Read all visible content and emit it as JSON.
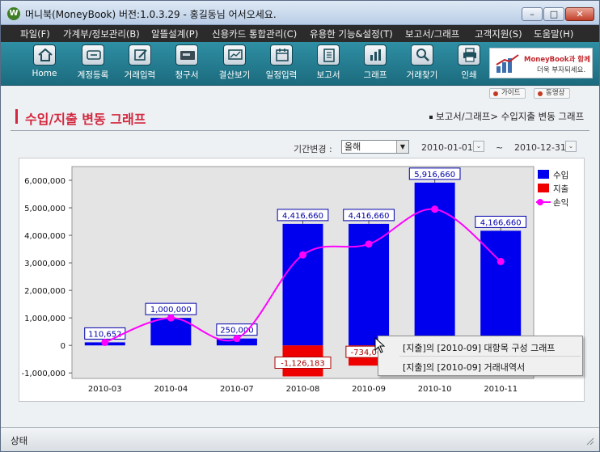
{
  "window": {
    "title": "머니북(MoneyBook) 버전:1.0.3.29 - 홍길동님 어서오세요.",
    "app_icon_letter": "W"
  },
  "menu": [
    "파일(F)",
    "가계부/정보관리(B)",
    "알뜰설계(P)",
    "신용카드 통합관리(C)",
    "유용한 기능&설정(T)",
    "보고서/그래프",
    "고객지원(S)",
    "도움말(H)"
  ],
  "toolbar": {
    "buttons": [
      {
        "label": "Home",
        "icon": "home-icon"
      },
      {
        "label": "계정등록",
        "icon": "account-register-icon"
      },
      {
        "label": "거래입력",
        "icon": "transaction-entry-icon"
      },
      {
        "label": "청구서",
        "icon": "bill-card-icon"
      },
      {
        "label": "결산보기",
        "icon": "settlement-monitor-icon"
      },
      {
        "label": "일정입력",
        "icon": "schedule-calendar-icon"
      },
      {
        "label": "보고서",
        "icon": "report-icon"
      },
      {
        "label": "그래프",
        "icon": "bar-graph-icon"
      },
      {
        "label": "거래찾기",
        "icon": "magnifier-icon"
      },
      {
        "label": "인쇄",
        "icon": "printer-icon"
      }
    ],
    "ad_line1": "MoneyBook과 함께",
    "ad_line2": "더욱 부자되세요."
  },
  "sub_buttons": {
    "guide": "가이드",
    "video": "동영상"
  },
  "page": {
    "title": "수입/지출 변동 그래프",
    "breadcrumb": "보고서/그래프> 수입지출 변동 그래프"
  },
  "filter": {
    "period_label": "기간변경 :",
    "period_value": "올해",
    "start_date": "2010-01-01",
    "end_date": "2010-12-31",
    "tilde": "~"
  },
  "chart_data": {
    "type": "bar",
    "categories": [
      "2010-03",
      "2010-04",
      "2010-07",
      "2010-08",
      "2010-09",
      "2010-10",
      "2010-11"
    ],
    "series": [
      {
        "name": "수입",
        "color": "#0000ee",
        "values": [
          110652,
          1000000,
          250000,
          4416660,
          4416660,
          5916660,
          4166660
        ]
      },
      {
        "name": "지출",
        "color": "#ee0000",
        "values": [
          0,
          0,
          0,
          -1126183,
          -734060,
          -150000,
          -150000
        ]
      },
      {
        "name": "손익",
        "color": "#ff00ff",
        "type": "line",
        "values": [
          110652,
          1000000,
          250000,
          3290477,
          3682600,
          4950000,
          3050000
        ]
      }
    ],
    "income_labels": [
      "110,652",
      "1,000,000",
      "250,000",
      "4,416,660",
      "4,416,660",
      "5,916,660",
      "4,166,660"
    ],
    "expense_labels": [
      "",
      "",
      "",
      "-1,126,183",
      "-734,060",
      "",
      ""
    ],
    "yticks": [
      "6,000,000",
      "5,000,000",
      "4,000,000",
      "3,000,000",
      "2,000,000",
      "1,000,000",
      "0",
      "-1,000,000"
    ],
    "ylim": [
      -1200000,
      6500000
    ],
    "grid": false,
    "legend_placement": "top-right"
  },
  "context_menu": {
    "items": [
      "[지출]의 [2010-09] 대항목 구성 그래프",
      "[지출]의 [2010-09] 거래내역서"
    ]
  },
  "status": {
    "text": "상태"
  }
}
